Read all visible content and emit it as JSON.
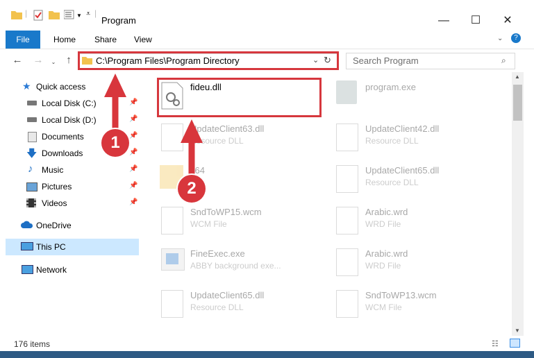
{
  "window": {
    "title": "Program"
  },
  "ribbon": {
    "tabs": [
      "File",
      "Home",
      "Share",
      "View"
    ]
  },
  "address": {
    "path": "C:\\Program Files\\Program Directory"
  },
  "search": {
    "placeholder": "Search Program"
  },
  "sidebar": {
    "items": [
      {
        "label": "Quick access",
        "icon": "star-icon",
        "pinned": false
      },
      {
        "label": "Local Disk (C:)",
        "icon": "drive-icon",
        "pinned": true
      },
      {
        "label": "Local Disk (D:)",
        "icon": "drive-icon",
        "pinned": true
      },
      {
        "label": "Documents",
        "icon": "documents-icon",
        "pinned": true
      },
      {
        "label": "Downloads",
        "icon": "download-icon",
        "pinned": true
      },
      {
        "label": "Music",
        "icon": "music-icon",
        "pinned": true
      },
      {
        "label": "Pictures",
        "icon": "pictures-icon",
        "pinned": true
      },
      {
        "label": "Videos",
        "icon": "videos-icon",
        "pinned": true
      },
      {
        "label": "OneDrive",
        "icon": "cloud-icon",
        "pinned": false
      },
      {
        "label": "This PC",
        "icon": "computer-icon",
        "pinned": false
      },
      {
        "label": "Network",
        "icon": "network-icon",
        "pinned": false
      }
    ]
  },
  "files": [
    {
      "name": "fideu.dll",
      "type": ""
    },
    {
      "name": "program.exe",
      "type": ""
    },
    {
      "name": "UpdateClient63.dll",
      "type": "Resource DLL"
    },
    {
      "name": "UpdateClient42.dll",
      "type": "Resource DLL"
    },
    {
      "name": "x64",
      "type": ""
    },
    {
      "name": "UpdateClient65.dll",
      "type": "Resource DLL"
    },
    {
      "name": "SndToWP15.wcm",
      "type": "WCM File"
    },
    {
      "name": "Arabic.wrd",
      "type": "WRD File"
    },
    {
      "name": "FineExec.exe",
      "type": "ABBY background exe..."
    },
    {
      "name": "Arabic.wrd",
      "type": "WRD File"
    },
    {
      "name": "UpdateClient65.dll",
      "type": "Resource DLL"
    },
    {
      "name": "SndToWP13.wcm",
      "type": "WCM File"
    }
  ],
  "status": {
    "items_count": "176 items"
  },
  "annotations": {
    "step1": "1",
    "step2": "2"
  },
  "colors": {
    "accent": "#1979ca",
    "highlight": "#d6373d"
  }
}
